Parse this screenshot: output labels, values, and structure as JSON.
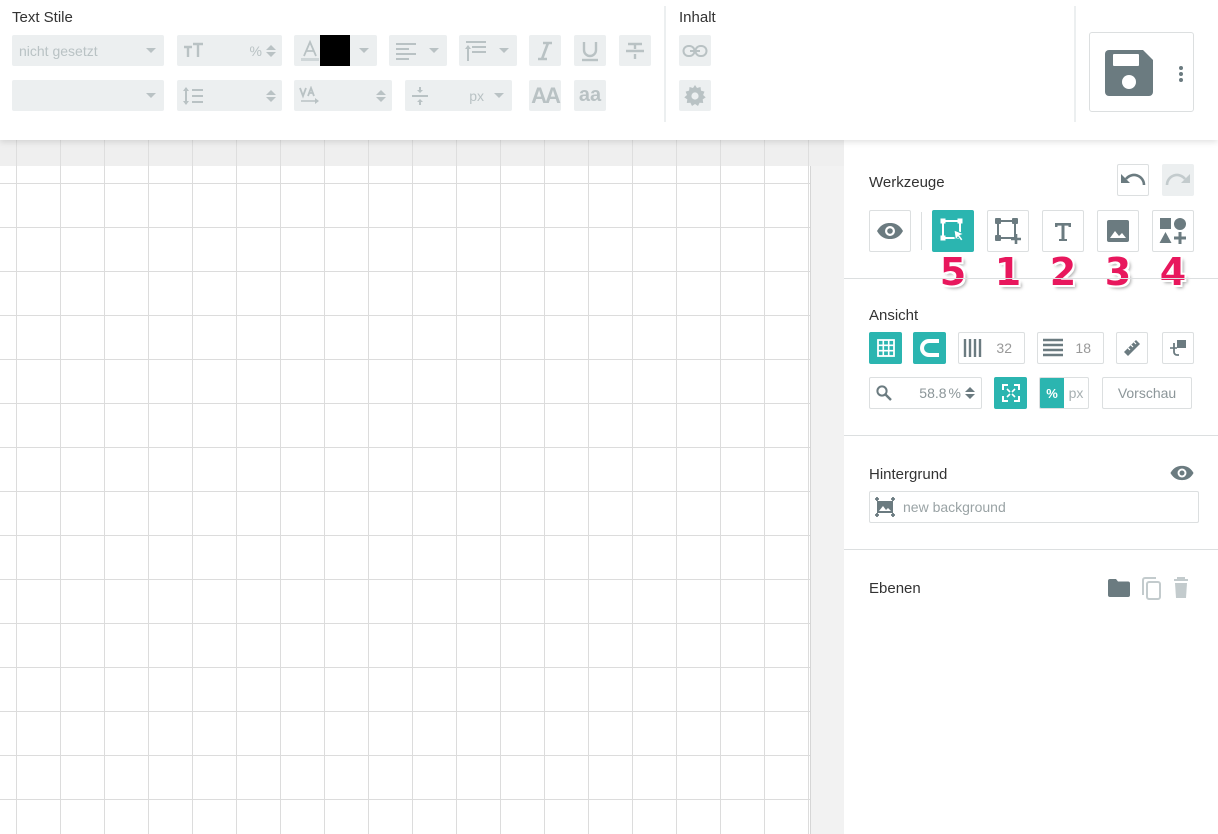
{
  "toolbar": {
    "text_style_title": "Text Stile",
    "content_title": "Inhalt",
    "font_select_value": "nicht gesetzt",
    "font_size_unit": "%",
    "spacing_unit": "px",
    "text_color": "#000000",
    "case_upper_label": "AA",
    "case_lower_label": "aa"
  },
  "panel": {
    "tools_title": "Werkzeuge",
    "view_title": "Ansicht",
    "columns_value": "32",
    "rows_value": "18",
    "zoom_value": "58.8",
    "zoom_unit": "%",
    "unit_percent": "%",
    "unit_px": "px",
    "preview_label": "Vorschau",
    "background_title": "Hintergrund",
    "background_placeholder": "new background",
    "layers_title": "Ebenen"
  },
  "annotations": {
    "select_tool": "5",
    "frame_tool": "1",
    "text_tool": "2",
    "image_tool": "3",
    "shapes_tool": "4"
  },
  "colors": {
    "accent": "#2bb5b0",
    "annotation": "#e8175d",
    "icon": "#6b7b80",
    "disabled": "#b9c2c4"
  }
}
